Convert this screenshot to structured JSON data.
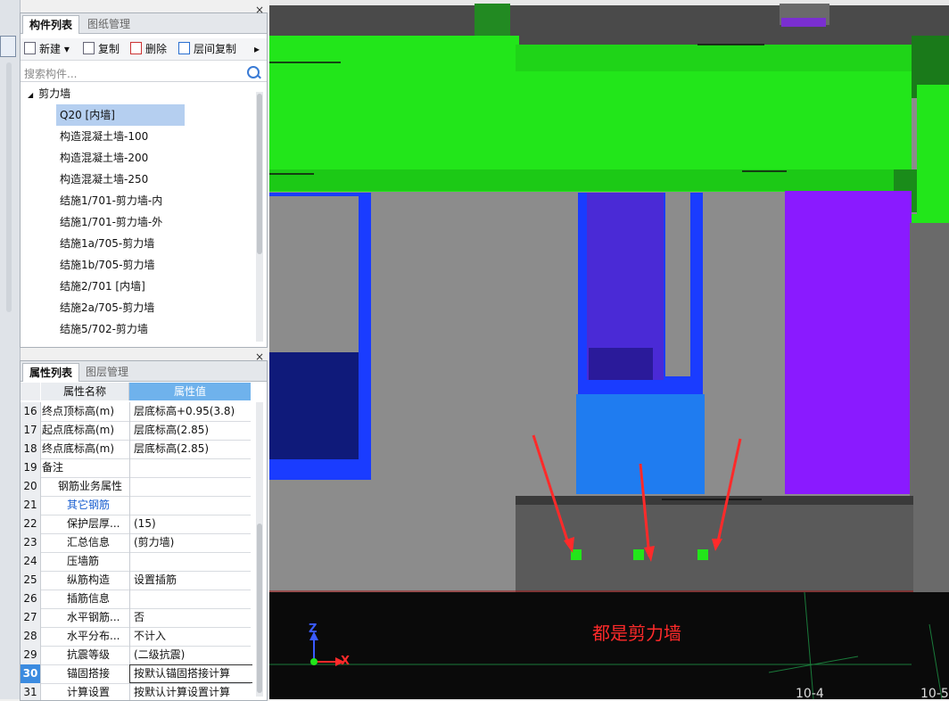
{
  "component_panel": {
    "tabs": [
      "构件列表",
      "图纸管理"
    ],
    "toolbar": {
      "new_label": "新建",
      "copy_label": "复制",
      "delete_label": "删除",
      "floor_copy_label": "层间复制"
    },
    "search_placeholder": "搜索构件...",
    "tree_root": "剪力墙",
    "items": [
      "Q20 [内墙]",
      "构造混凝土墙-100",
      "构造混凝土墙-200",
      "构造混凝土墙-250",
      "结施1/701-剪力墙-内",
      "结施1/701-剪力墙-外",
      "结施1a/705-剪力墙",
      "结施1b/705-剪力墙",
      "结施2/701 [内墙]",
      "结施2a/705-剪力墙",
      "结施5/702-剪力墙"
    ],
    "selected_index": 0
  },
  "property_panel": {
    "tabs": [
      "属性列表",
      "图层管理"
    ],
    "col_name": "属性名称",
    "col_value": "属性值",
    "rows": [
      {
        "num": "16",
        "name": "终点顶标高(m)",
        "value": "层底标高+0.95(3.8)"
      },
      {
        "num": "17",
        "name": "起点底标高(m)",
        "value": "层底标高(2.85)"
      },
      {
        "num": "18",
        "name": "终点底标高(m)",
        "value": "层底标高(2.85)"
      },
      {
        "num": "19",
        "name": "备注",
        "value": ""
      },
      {
        "num": "20",
        "name": "钢筋业务属性",
        "value": ""
      },
      {
        "num": "21",
        "name": "其它钢筋",
        "value": ""
      },
      {
        "num": "22",
        "name": "保护层厚...",
        "value": "(15)"
      },
      {
        "num": "23",
        "name": "汇总信息",
        "value": "(剪力墙)"
      },
      {
        "num": "24",
        "name": "压墙筋",
        "value": ""
      },
      {
        "num": "25",
        "name": "纵筋构造",
        "value": "设置插筋"
      },
      {
        "num": "26",
        "name": "插筋信息",
        "value": ""
      },
      {
        "num": "27",
        "name": "水平钢筋...",
        "value": "否"
      },
      {
        "num": "28",
        "name": "水平分布...",
        "value": "不计入"
      },
      {
        "num": "29",
        "name": "抗震等级",
        "value": "(二级抗震)"
      },
      {
        "num": "30",
        "name": "锚固搭接",
        "value": "按默认锚固搭接计算"
      },
      {
        "num": "31",
        "name": "计算设置",
        "value": "按默认计算设置计算"
      }
    ]
  },
  "viewport": {
    "annotation": "都是剪力墙",
    "axis_x": "X",
    "axis_z": "Z",
    "grid_labels": [
      "10-4",
      "10-5"
    ],
    "colors": {
      "wall_green": "#22e61a",
      "wall_blue": "#1a3cff",
      "wall_purple": "#8a1aff",
      "annotation_red": "#ff2a2a"
    }
  }
}
